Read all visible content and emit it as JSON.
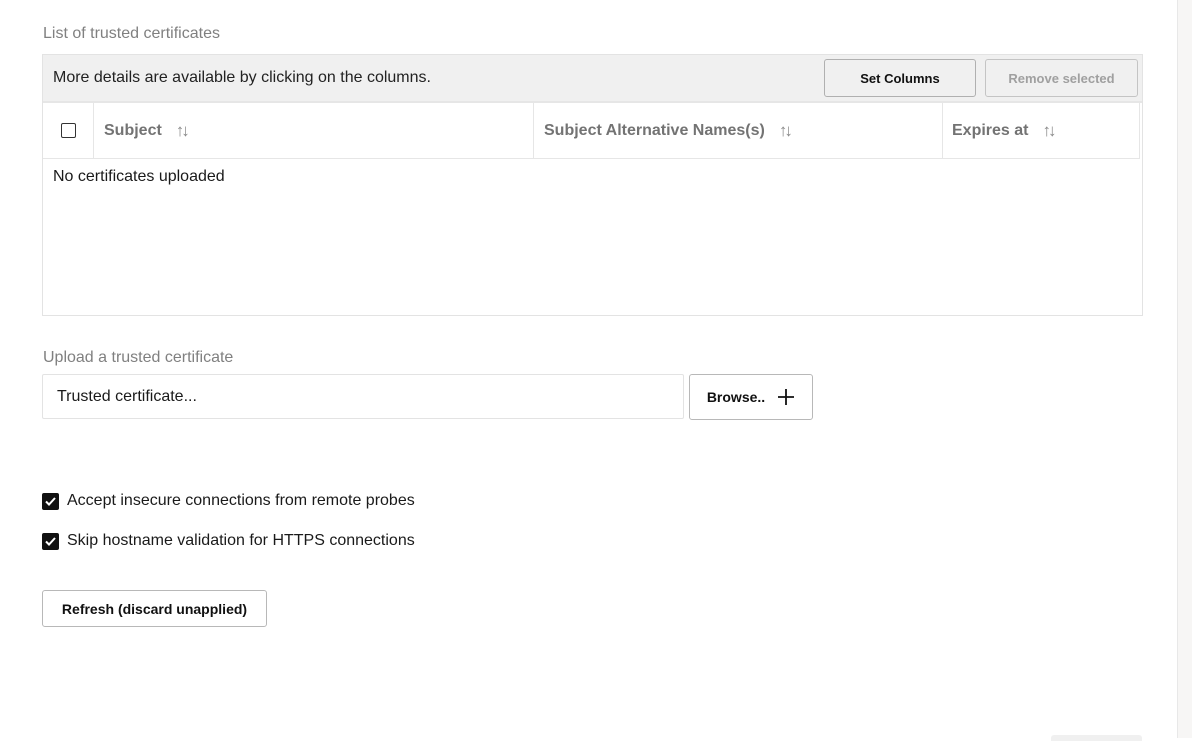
{
  "certificates": {
    "section_label": "List of trusted certificates",
    "toolbar_text": "More details are available by clicking on the columns.",
    "set_columns_label": "Set Columns",
    "remove_selected_label": "Remove selected",
    "columns": [
      {
        "label": "Subject",
        "sort_icon": "sort-up-down-icon"
      },
      {
        "label": "Subject Alternative Names(s)",
        "sort_icon": "sort-up-down-icon"
      },
      {
        "label": "Expires at",
        "sort_icon": "sort-up-down-icon"
      }
    ],
    "empty_message": "No certificates uploaded",
    "sort_glyph": "↑↓"
  },
  "upload": {
    "section_label": "Upload a trusted certificate",
    "input_placeholder": "Trusted certificate...",
    "browse_label": "Browse.."
  },
  "options": [
    {
      "label": "Accept insecure connections from remote probes",
      "checked": true
    },
    {
      "label": "Skip hostname validation for HTTPS connections",
      "checked": true
    }
  ],
  "refresh_label": "Refresh (discard unapplied)"
}
